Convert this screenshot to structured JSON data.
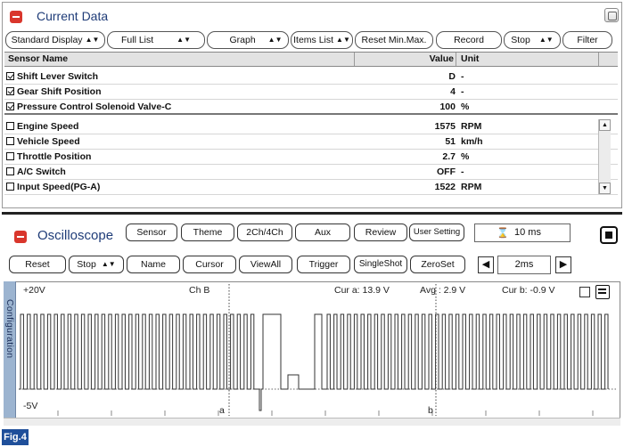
{
  "current_data": {
    "title": "Current Data",
    "toolbar": {
      "display_mode": "Standard Display",
      "list_mode": "Full List",
      "graph": "Graph",
      "items_list": "Items List",
      "reset_minmax": "Reset Min.Max.",
      "record": "Record",
      "stop": "Stop",
      "filter": "Filter"
    },
    "columns": {
      "name": "Sensor Name",
      "value": "Value",
      "unit": "Unit"
    },
    "selected_rows": [
      {
        "name": "Shift Lever Switch",
        "value": "D",
        "unit": "-",
        "checked": true
      },
      {
        "name": "Gear Shift Position",
        "value": "4",
        "unit": "-",
        "checked": true
      },
      {
        "name": "Pressure Control Solenoid Valve-C",
        "value": "100",
        "unit": "%",
        "checked": true
      }
    ],
    "rows": [
      {
        "name": "Engine Speed",
        "value": "1575",
        "unit": "RPM",
        "checked": false
      },
      {
        "name": "Vehicle Speed",
        "value": "51",
        "unit": "km/h",
        "checked": false
      },
      {
        "name": "Throttle Position",
        "value": "2.7",
        "unit": "%",
        "checked": false
      },
      {
        "name": "A/C Switch",
        "value": "OFF",
        "unit": "-",
        "checked": false
      },
      {
        "name": "Input Speed(PG-A)",
        "value": "1522",
        "unit": "RPM",
        "checked": false
      }
    ]
  },
  "oscilloscope": {
    "title": "Oscilloscope",
    "toolbar1": {
      "sensor": "Sensor",
      "theme": "Theme",
      "channels": "2Ch/4Ch",
      "aux": "Aux",
      "review": "Review",
      "user_setting": "User Setting",
      "time_readout": "10 ms"
    },
    "toolbar2": {
      "reset": "Reset",
      "stop": "Stop",
      "name": "Name",
      "cursor": "Cursor",
      "view_all": "ViewAll",
      "trigger": "Trigger",
      "single_shot": "SingleShot",
      "zero_set": "ZeroSet",
      "time_div": "2ms"
    },
    "side_tab": "Configuration",
    "display": {
      "y_max": "+20V",
      "y_min": "-5V",
      "channel": "Ch B",
      "cursor_a": "Cur a: 13.9 V",
      "average": "Avg : 2.9 V",
      "cursor_b": "Cur b: -0.9 V",
      "marker_a": "a",
      "marker_b": "b"
    }
  },
  "figure_label": "Fig.4",
  "colors": {
    "accent_red": "#d9362c",
    "title_blue": "#1f3c78",
    "config_tab": "#9cb4d0",
    "fig_label_bg": "#1f4f9a"
  }
}
